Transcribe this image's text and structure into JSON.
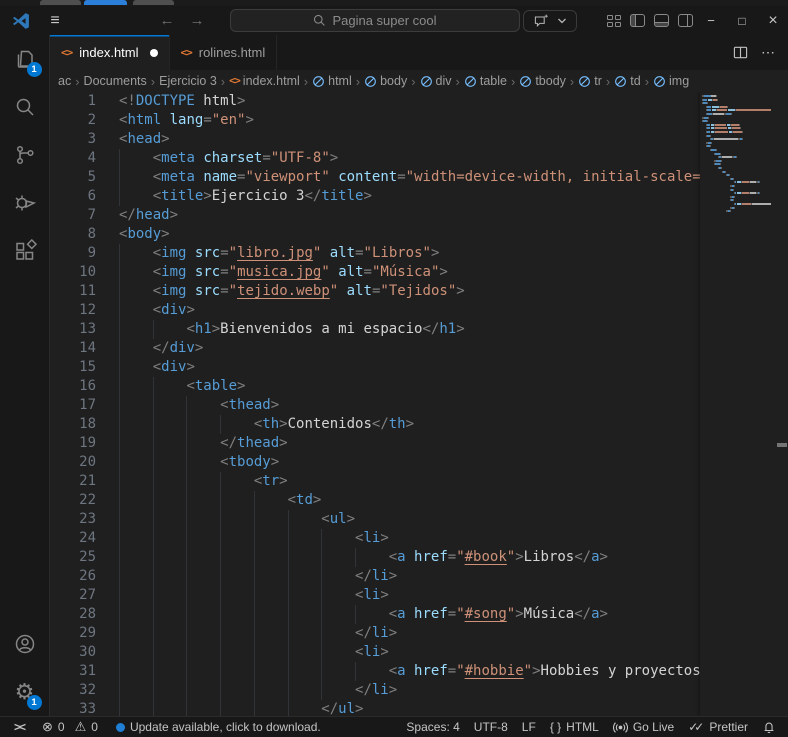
{
  "colors": {
    "accent": "#0078d4",
    "badge": "#0078d4",
    "update_dot": "#1f7fd4",
    "tab_icon_orange": "#e37933",
    "symbol_icon_blue": "#75beff",
    "logo_blue": "#2e77b8",
    "background_tab_gray": "#4f4f4f",
    "background_tab_blue": "#2b7fd9"
  },
  "background_tabs": [
    {
      "name": "background-window-tab",
      "color": "#4f4f4f"
    },
    {
      "name": "background-window-tab-active",
      "color": "#2b7fd9"
    },
    {
      "name": "background-window-tab",
      "color": "#4f4f4f"
    }
  ],
  "titlebar": {
    "search_placeholder": "Pagina super cool",
    "icons": {
      "menu": "≡",
      "back": "←",
      "forward": "→",
      "minimize": "−",
      "maximize": "□",
      "close": "×"
    }
  },
  "tabs": [
    {
      "label": "index.html",
      "active": true,
      "modified": true
    },
    {
      "label": "rolines.html",
      "active": false,
      "modified": false
    }
  ],
  "tab_actions": {
    "split_editor": "split-editor-icon",
    "more": "⋯"
  },
  "breadcrumb": [
    {
      "label": "ac",
      "icon": "none"
    },
    {
      "label": "Documents",
      "icon": "none"
    },
    {
      "label": "Ejercicio 3",
      "icon": "none"
    },
    {
      "label": "index.html",
      "icon": "file"
    },
    {
      "label": "html",
      "icon": "symbol"
    },
    {
      "label": "body",
      "icon": "symbol"
    },
    {
      "label": "div",
      "icon": "symbol"
    },
    {
      "label": "table",
      "icon": "symbol"
    },
    {
      "label": "tbody",
      "icon": "symbol"
    },
    {
      "label": "tr",
      "icon": "symbol"
    },
    {
      "label": "td",
      "icon": "symbol"
    },
    {
      "label": "img",
      "icon": "symbol"
    }
  ],
  "crumb_sep": "›",
  "file_icon_glyph": "<>",
  "activitybar": {
    "top": [
      {
        "name": "explorer",
        "badge": "1"
      },
      {
        "name": "search"
      },
      {
        "name": "source-control"
      },
      {
        "name": "run-and-debug"
      },
      {
        "name": "extensions"
      }
    ],
    "bottom": [
      {
        "name": "accounts"
      },
      {
        "name": "settings",
        "badge": "1",
        "glyph": "⚙"
      }
    ]
  },
  "code": {
    "lines": [
      {
        "indent": 0,
        "tokens": [
          [
            "<!",
            "p"
          ],
          [
            "DOCTYPE",
            "t"
          ],
          [
            " html",
            "x"
          ],
          [
            ">",
            "p"
          ]
        ]
      },
      {
        "indent": 0,
        "tokens": [
          [
            "<",
            "p"
          ],
          [
            "html",
            "t"
          ],
          [
            " ",
            "x"
          ],
          [
            "lang",
            "a"
          ],
          [
            "=",
            "p"
          ],
          [
            "\"en\"",
            "s"
          ],
          [
            ">",
            "p"
          ]
        ]
      },
      {
        "indent": 0,
        "tokens": [
          [
            "<",
            "p"
          ],
          [
            "head",
            "t"
          ],
          [
            ">",
            "p"
          ]
        ]
      },
      {
        "indent": 4,
        "tokens": [
          [
            "<",
            "p"
          ],
          [
            "meta",
            "t"
          ],
          [
            " ",
            "x"
          ],
          [
            "charset",
            "a"
          ],
          [
            "=",
            "p"
          ],
          [
            "\"UTF-8\"",
            "s"
          ],
          [
            ">",
            "p"
          ]
        ]
      },
      {
        "indent": 4,
        "tokens": [
          [
            "<",
            "p"
          ],
          [
            "meta",
            "t"
          ],
          [
            " ",
            "x"
          ],
          [
            "name",
            "a"
          ],
          [
            "=",
            "p"
          ],
          [
            "\"viewport\"",
            "s"
          ],
          [
            " ",
            "x"
          ],
          [
            "content",
            "a"
          ],
          [
            "=",
            "p"
          ],
          [
            "\"width=device-width, initial-scale=",
            "s"
          ]
        ]
      },
      {
        "indent": 4,
        "tokens": [
          [
            "<",
            "p"
          ],
          [
            "title",
            "t"
          ],
          [
            ">",
            "p"
          ],
          [
            "Ejercicio 3",
            "x"
          ],
          [
            "</",
            "p"
          ],
          [
            "title",
            "t"
          ],
          [
            ">",
            "p"
          ]
        ]
      },
      {
        "indent": 0,
        "tokens": [
          [
            "</",
            "p"
          ],
          [
            "head",
            "t"
          ],
          [
            ">",
            "p"
          ]
        ]
      },
      {
        "indent": 0,
        "tokens": [
          [
            "<",
            "p"
          ],
          [
            "body",
            "t"
          ],
          [
            ">",
            "p"
          ]
        ]
      },
      {
        "indent": 4,
        "tokens": [
          [
            "<",
            "p"
          ],
          [
            "img",
            "t"
          ],
          [
            " ",
            "x"
          ],
          [
            "src",
            "a"
          ],
          [
            "=",
            "p"
          ],
          [
            "\"",
            "s"
          ],
          [
            "libro.jpg",
            "u"
          ],
          [
            "\"",
            "s"
          ],
          [
            " ",
            "x"
          ],
          [
            "alt",
            "a"
          ],
          [
            "=",
            "p"
          ],
          [
            "\"Libros\"",
            "s"
          ],
          [
            ">",
            "p"
          ]
        ]
      },
      {
        "indent": 4,
        "tokens": [
          [
            "<",
            "p"
          ],
          [
            "img",
            "t"
          ],
          [
            " ",
            "x"
          ],
          [
            "src",
            "a"
          ],
          [
            "=",
            "p"
          ],
          [
            "\"",
            "s"
          ],
          [
            "musica.jpg",
            "u"
          ],
          [
            "\"",
            "s"
          ],
          [
            " ",
            "x"
          ],
          [
            "alt",
            "a"
          ],
          [
            "=",
            "p"
          ],
          [
            "\"Música\"",
            "s"
          ],
          [
            ">",
            "p"
          ]
        ]
      },
      {
        "indent": 4,
        "tokens": [
          [
            "<",
            "p"
          ],
          [
            "img",
            "t"
          ],
          [
            " ",
            "x"
          ],
          [
            "src",
            "a"
          ],
          [
            "=",
            "p"
          ],
          [
            "\"",
            "s"
          ],
          [
            "tejido.webp",
            "u"
          ],
          [
            "\"",
            "s"
          ],
          [
            " ",
            "x"
          ],
          [
            "alt",
            "a"
          ],
          [
            "=",
            "p"
          ],
          [
            "\"Tejidos\"",
            "s"
          ],
          [
            ">",
            "p"
          ]
        ]
      },
      {
        "indent": 4,
        "tokens": [
          [
            "<",
            "p"
          ],
          [
            "div",
            "t"
          ],
          [
            ">",
            "p"
          ]
        ]
      },
      {
        "indent": 8,
        "tokens": [
          [
            "<",
            "p"
          ],
          [
            "h1",
            "t"
          ],
          [
            ">",
            "p"
          ],
          [
            "Bienvenidos a mi espacio",
            "x"
          ],
          [
            "</",
            "p"
          ],
          [
            "h1",
            "t"
          ],
          [
            ">",
            "p"
          ]
        ]
      },
      {
        "indent": 4,
        "tokens": [
          [
            "</",
            "p"
          ],
          [
            "div",
            "t"
          ],
          [
            ">",
            "p"
          ]
        ]
      },
      {
        "indent": 4,
        "tokens": [
          [
            "<",
            "p"
          ],
          [
            "div",
            "t"
          ],
          [
            ">",
            "p"
          ]
        ]
      },
      {
        "indent": 8,
        "tokens": [
          [
            "<",
            "p"
          ],
          [
            "table",
            "t"
          ],
          [
            ">",
            "p"
          ]
        ]
      },
      {
        "indent": 12,
        "tokens": [
          [
            "<",
            "p"
          ],
          [
            "thead",
            "t"
          ],
          [
            ">",
            "p"
          ]
        ]
      },
      {
        "indent": 16,
        "tokens": [
          [
            "<",
            "p"
          ],
          [
            "th",
            "t"
          ],
          [
            ">",
            "p"
          ],
          [
            "Contenidos",
            "x"
          ],
          [
            "</",
            "p"
          ],
          [
            "th",
            "t"
          ],
          [
            ">",
            "p"
          ]
        ]
      },
      {
        "indent": 12,
        "tokens": [
          [
            "</",
            "p"
          ],
          [
            "thead",
            "t"
          ],
          [
            ">",
            "p"
          ]
        ]
      },
      {
        "indent": 12,
        "tokens": [
          [
            "<",
            "p"
          ],
          [
            "tbody",
            "t"
          ],
          [
            ">",
            "p"
          ]
        ]
      },
      {
        "indent": 16,
        "tokens": [
          [
            "<",
            "p"
          ],
          [
            "tr",
            "t"
          ],
          [
            ">",
            "p"
          ]
        ]
      },
      {
        "indent": 20,
        "tokens": [
          [
            "<",
            "p"
          ],
          [
            "td",
            "t"
          ],
          [
            ">",
            "p"
          ]
        ]
      },
      {
        "indent": 24,
        "tokens": [
          [
            "<",
            "p"
          ],
          [
            "ul",
            "t"
          ],
          [
            ">",
            "p"
          ]
        ]
      },
      {
        "indent": 28,
        "tokens": [
          [
            "<",
            "p"
          ],
          [
            "li",
            "t"
          ],
          [
            ">",
            "p"
          ]
        ]
      },
      {
        "indent": 32,
        "tokens": [
          [
            "<",
            "p"
          ],
          [
            "a",
            "t"
          ],
          [
            " ",
            "x"
          ],
          [
            "href",
            "a"
          ],
          [
            "=",
            "p"
          ],
          [
            "\"",
            "s"
          ],
          [
            "#book",
            "u"
          ],
          [
            "\"",
            "s"
          ],
          [
            ">",
            "p"
          ],
          [
            "Libros",
            "x"
          ],
          [
            "</",
            "p"
          ],
          [
            "a",
            "t"
          ],
          [
            ">",
            "p"
          ]
        ]
      },
      {
        "indent": 28,
        "tokens": [
          [
            "</",
            "p"
          ],
          [
            "li",
            "t"
          ],
          [
            ">",
            "p"
          ]
        ]
      },
      {
        "indent": 28,
        "tokens": [
          [
            "<",
            "p"
          ],
          [
            "li",
            "t"
          ],
          [
            ">",
            "p"
          ]
        ]
      },
      {
        "indent": 32,
        "tokens": [
          [
            "<",
            "p"
          ],
          [
            "a",
            "t"
          ],
          [
            " ",
            "x"
          ],
          [
            "href",
            "a"
          ],
          [
            "=",
            "p"
          ],
          [
            "\"",
            "s"
          ],
          [
            "#song",
            "u"
          ],
          [
            "\"",
            "s"
          ],
          [
            ">",
            "p"
          ],
          [
            "Música",
            "x"
          ],
          [
            "</",
            "p"
          ],
          [
            "a",
            "t"
          ],
          [
            ">",
            "p"
          ]
        ]
      },
      {
        "indent": 28,
        "tokens": [
          [
            "</",
            "p"
          ],
          [
            "li",
            "t"
          ],
          [
            ">",
            "p"
          ]
        ]
      },
      {
        "indent": 28,
        "tokens": [
          [
            "<",
            "p"
          ],
          [
            "li",
            "t"
          ],
          [
            ">",
            "p"
          ]
        ]
      },
      {
        "indent": 32,
        "tokens": [
          [
            "<",
            "p"
          ],
          [
            "a",
            "t"
          ],
          [
            " ",
            "x"
          ],
          [
            "href",
            "a"
          ],
          [
            "=",
            "p"
          ],
          [
            "\"",
            "s"
          ],
          [
            "#hobbie",
            "u"
          ],
          [
            "\"",
            "s"
          ],
          [
            ">",
            "p"
          ],
          [
            "Hobbies y proyectos",
            "x"
          ]
        ]
      },
      {
        "indent": 28,
        "tokens": [
          [
            "</",
            "p"
          ],
          [
            "li",
            "t"
          ],
          [
            ">",
            "p"
          ]
        ]
      },
      {
        "indent": 24,
        "tokens": [
          [
            "</",
            "p"
          ],
          [
            "ul",
            "t"
          ],
          [
            ">",
            "p"
          ]
        ]
      }
    ]
  },
  "statusbar": {
    "left": [
      {
        "name": "remote-indicator",
        "icon": "remote",
        "glyph": "><"
      },
      {
        "name": "problems",
        "icon": "problems",
        "error_glyph": "⊗",
        "errors": "0",
        "warning_glyph": "⚠",
        "warnings": "0"
      },
      {
        "name": "update-notification",
        "icon": "dot",
        "label": "Update available, click to download."
      }
    ],
    "right": [
      {
        "name": "indentation",
        "label": "Spaces: 4"
      },
      {
        "name": "encoding",
        "label": "UTF-8"
      },
      {
        "name": "eol-sequence",
        "label": "LF"
      },
      {
        "name": "language-mode",
        "icon": "braces",
        "glyph": "{ }",
        "label": "HTML"
      },
      {
        "name": "go-live",
        "icon": "broadcast",
        "label": "Go Live"
      },
      {
        "name": "prettier",
        "icon": "double-check",
        "glyph": "✓✓",
        "label": "Prettier"
      },
      {
        "name": "notifications",
        "icon": "bell"
      }
    ]
  }
}
